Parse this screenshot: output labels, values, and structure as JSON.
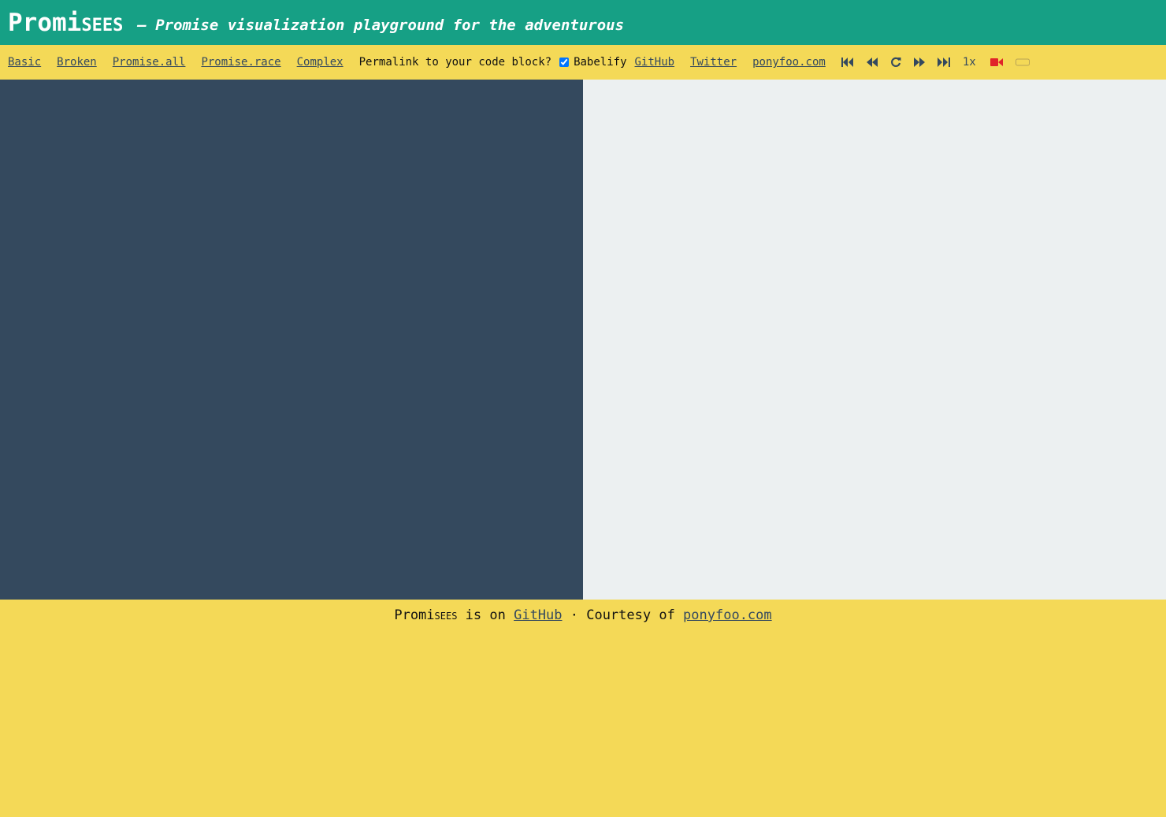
{
  "header": {
    "logo_main": "Promi",
    "logo_sees": "SEES",
    "tagline": "— Promise visualization playground for the adventurous"
  },
  "toolbar": {
    "examples": [
      "Basic",
      "Broken",
      "Promise.all",
      "Promise.race",
      "Complex"
    ],
    "permalink_text": "Permalink to your code block?",
    "babelify_label": "Babelify",
    "babelify_checked": true,
    "links": [
      "GitHub",
      "Twitter",
      "ponyfoo.com"
    ],
    "controls": [
      "first-icon",
      "back-icon",
      "replay-icon",
      "forward-icon",
      "last-icon"
    ],
    "speed": "1x",
    "record_icon": "video-camera-icon",
    "toggle_icon": "toggle-icon",
    "record_color": "#e0242a"
  },
  "footer": {
    "brand_main": "Promi",
    "brand_sees": "SEES",
    "text_is_on": " is on ",
    "github": "GitHub",
    "separator": " · Courtesy of ",
    "ponyfoo": "ponyfoo.com"
  },
  "colors": {
    "header_bg": "#16a085",
    "toolbar_bg": "#f4d957",
    "editor_bg": "#34495e",
    "visual_bg": "#ecf0f1"
  }
}
